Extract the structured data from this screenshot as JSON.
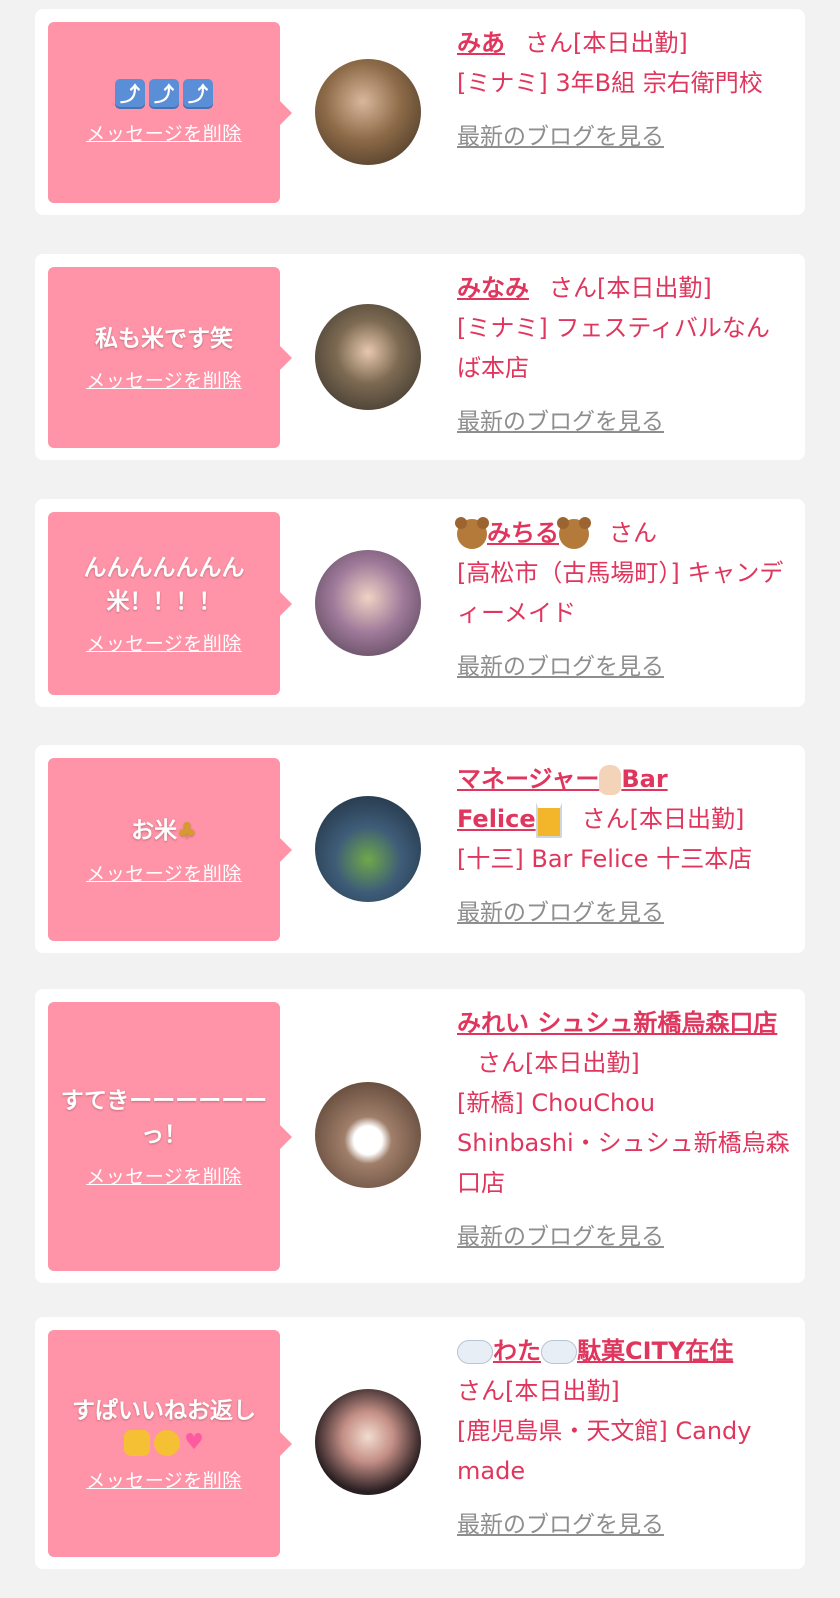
{
  "delete_label": "メッセージを削除",
  "blog_label": "最新のブログを見る",
  "san": "さん",
  "cards": [
    {
      "message": "",
      "message_icons": [
        "up-arrow-icon",
        "up-arrow-icon",
        "up-arrow-icon"
      ],
      "arrow_glyph": "⤴",
      "name": "みあ",
      "status": "[本日出勤]",
      "shop": "[ミナミ] 3年B組 宗右衛門校",
      "avatar_color": "#6b5a3a"
    },
    {
      "message": "私も米です笑",
      "name": "みなみ",
      "status": "[本日出勤]",
      "shop": "[ミナミ] フェスティバルなんば本店",
      "avatar_color": "#4d4a3e"
    },
    {
      "message": "んんんんんんん米！！！！",
      "name": "みちる",
      "status": "",
      "shop": "[高松市（古馬場町）] キャンディーメイド",
      "avatar_color": "#8a6f86"
    },
    {
      "message": "お米",
      "name_line1": "マネージャー",
      "name_line2a": "Bar",
      "name_line2b": "Felice",
      "status": "[本日出勤]",
      "shop": "[十三] Bar Felice 十三本店",
      "avatar_color": "#273a4c"
    },
    {
      "message": "すてきーーーーーーっ！",
      "name": "みれい シュシュ新橋烏森口店",
      "status": "[本日出勤]",
      "shop": "[新橋] ChouChou Shinbashi・シュシュ新橋烏森口店",
      "avatar_color": "#5e4a40"
    },
    {
      "message": "すぱいいねお返し",
      "name": "わた",
      "name_tail": "駄菓CITY在住",
      "status": "[本日出勤]",
      "shop": "[鹿児島県・天文館] Candy made",
      "avatar_color": "#5a4548"
    }
  ]
}
